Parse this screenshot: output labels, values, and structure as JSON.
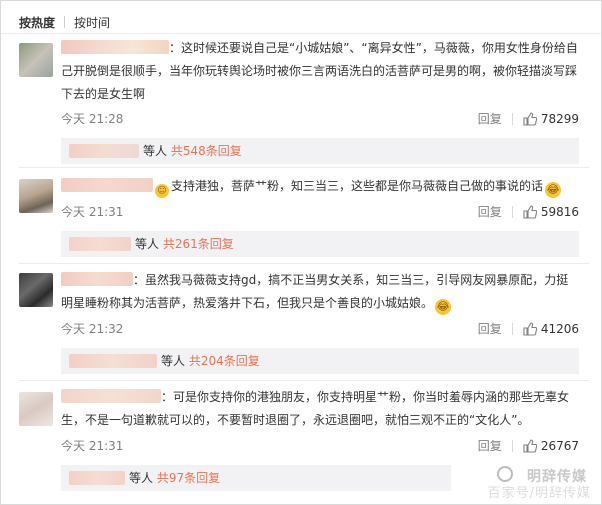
{
  "sort": {
    "hot_label": "按热度",
    "time_label": "按时间"
  },
  "colors": {
    "accent": "#eb7350",
    "muted": "#808080",
    "reply_bg": "#f2f2f5"
  },
  "comments": [
    {
      "text_suffix": "：这时候还要说自己是“小城姑娘”、“离异女性”，马薇薇，你用女性身份给自己开脱倒是很顺手，当年你玩转舆论场时被你三言两语洗白的活菩萨可是男的啊，被你轻描淡写踩下去的是女生啊",
      "time": "今天 21:28",
      "reply_label": "回复",
      "likes": "78299",
      "reply_box": {
        "prefix": "等人",
        "count_text": "共548条回复"
      }
    },
    {
      "text_suffix": "支持港独，菩萨艹粉，知三当三，这些都是你马薇薇自己做的事说的话",
      "time": "今天 21:31",
      "reply_label": "回复",
      "likes": "59816",
      "reply_box": {
        "prefix": "等人",
        "count_text": "共261条回复"
      }
    },
    {
      "text_suffix": "：虽然我马薇薇支持gd，搞不正当男女关系，知三当三，引导网友网暴原配，力挺明星睡粉称其为活菩萨，热爱落井下石，但我只是个善良的小城姑娘。",
      "time": "今天 21:32",
      "reply_label": "回复",
      "likes": "41206",
      "reply_box": {
        "prefix": "等人",
        "count_text": "共204条回复"
      }
    },
    {
      "text_suffix": "：可是你支持你的港独朋友，你支持明星艹粉，你当时羞辱内涵的那些无辜女生，不是一句道歉就可以的，不要暂时退圈了，永远退圈吧，就怕三观不正的“文化人”。",
      "time": "今天 21:31",
      "reply_label": "回复",
      "likes": "26767",
      "reply_box": {
        "prefix": "等人",
        "count_text": "共97条回复"
      }
    }
  ],
  "watermark": {
    "line1": "明辞传媒",
    "line2": "百家号/明辞传媒"
  },
  "icons": {
    "like": "thumbs-up-icon",
    "emoji": "crying-face-icon"
  }
}
